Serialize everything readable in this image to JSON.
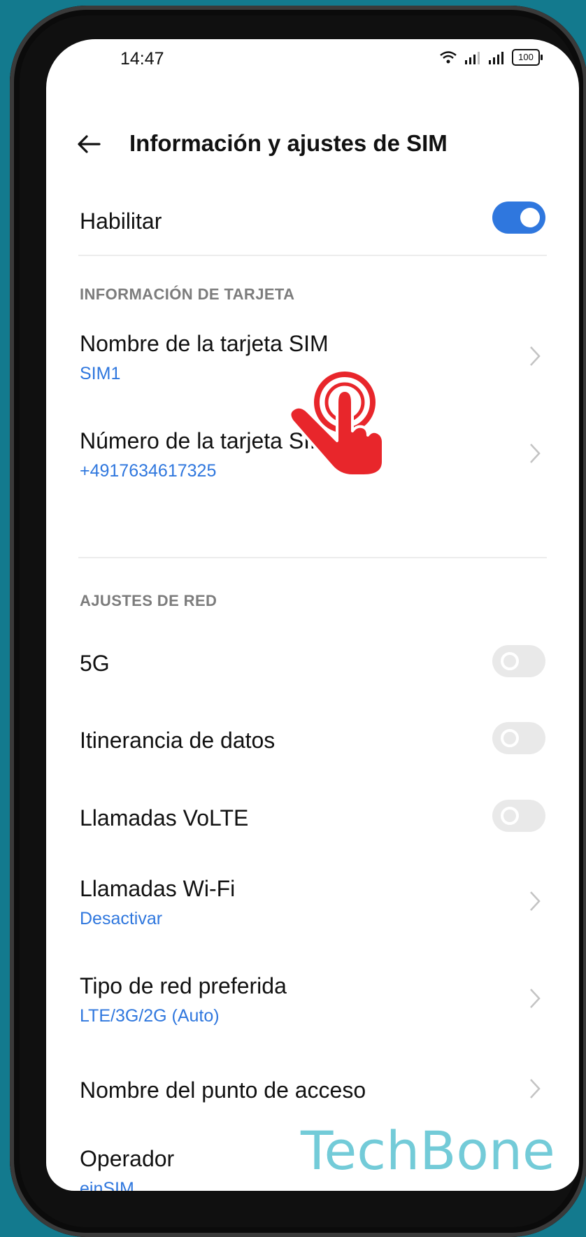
{
  "status_bar": {
    "time": "14:47",
    "battery": "100"
  },
  "header": {
    "title": "Información y ajustes de SIM"
  },
  "enable": {
    "label": "Habilitar",
    "toggle_on": true
  },
  "sections": {
    "card_info": "INFORMACIÓN DE TARJETA",
    "network": "AJUSTES DE RED"
  },
  "card_items": [
    {
      "title": "Nombre de la tarjeta SIM",
      "sub": "SIM1"
    },
    {
      "title": "Número de la tarjeta SIM",
      "sub": "+4917634617325"
    }
  ],
  "network_toggles": [
    {
      "title": "5G",
      "on": false
    },
    {
      "title": "Itinerancia de datos",
      "on": false
    },
    {
      "title": "Llamadas VoLTE",
      "on": false
    }
  ],
  "network_items": [
    {
      "title": "Llamadas Wi-Fi",
      "sub": "Desactivar"
    },
    {
      "title": "Tipo de red preferida",
      "sub": "LTE/3G/2G (Auto)"
    },
    {
      "title": "Nombre del punto de acceso",
      "sub": ""
    },
    {
      "title": "Operador",
      "sub": "einSIM"
    }
  ],
  "watermark": "TechBone",
  "colors": {
    "accent": "#2f77de",
    "hand": "#e8262b",
    "background": "#137a8e"
  }
}
